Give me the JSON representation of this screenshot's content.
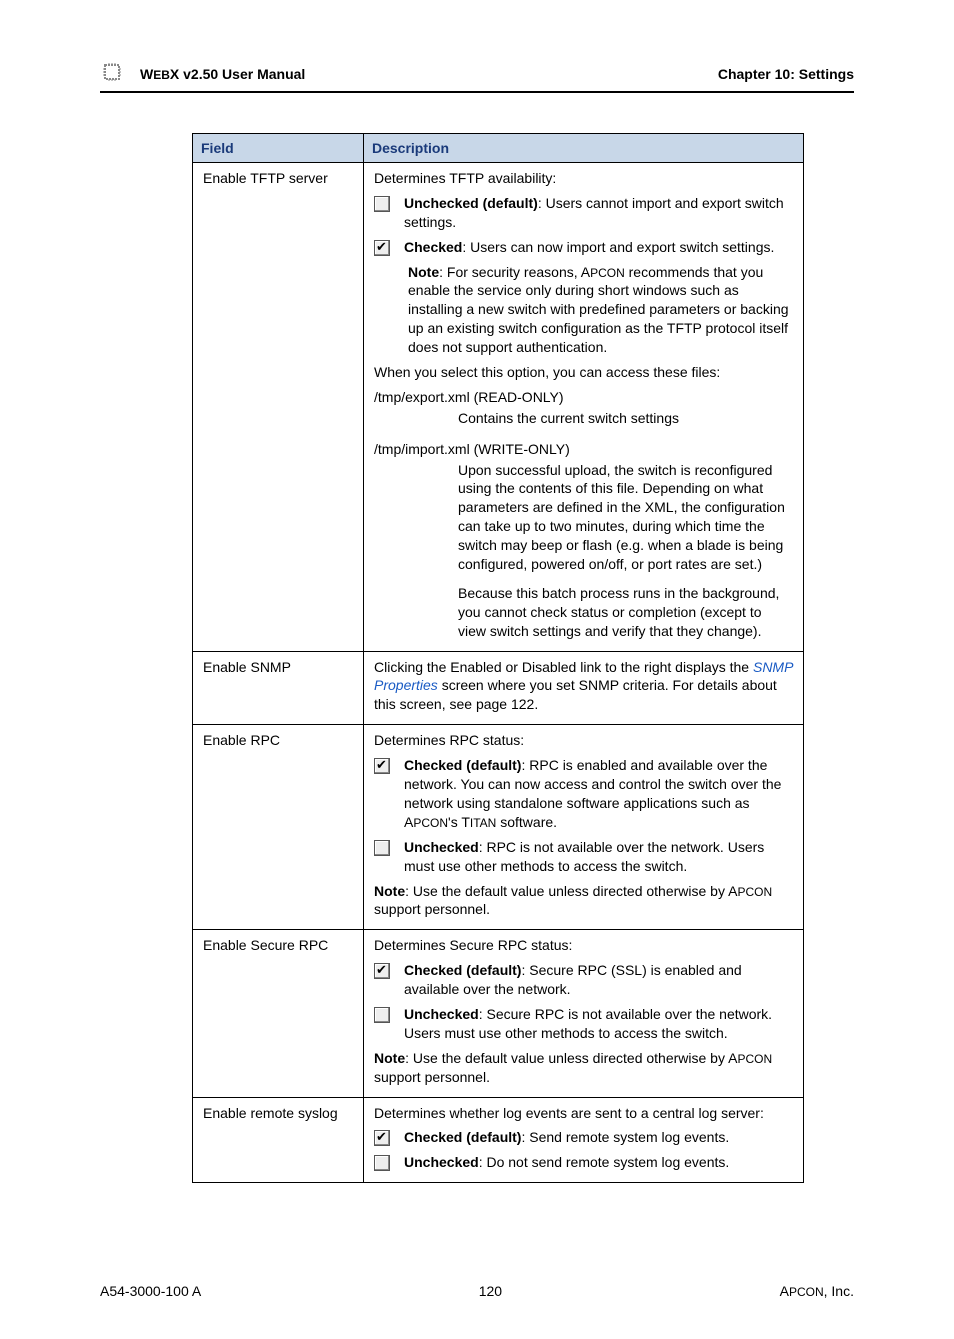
{
  "header": {
    "doc_title_prefix": "W",
    "doc_title_smallcaps": "EB",
    "doc_title_rest": "X v2.50 User Manual",
    "chapter": "Chapter 10: Settings"
  },
  "table": {
    "col1": "Field",
    "col2": "Description",
    "rows": {
      "tftp": {
        "field": "Enable TFTP server",
        "intro": "Determines TFTP availability:",
        "unchecked_bold": "Unchecked (default)",
        "unchecked_text": ": Users cannot import and export switch settings.",
        "checked_bold": "Checked",
        "checked_text": ": Users can now import and export switch settings.",
        "note_bold": "Note",
        "note_text_1": ": For security reasons, A",
        "note_text_smallcaps": "PCON",
        "note_text_2": " recommends that you enable the service only during short windows such as installing a new switch with predefined parameters or backing up an existing switch configuration as the TFTP protocol itself does not support authentication.",
        "access_line": "When you select this option, you can access these files:",
        "export_path": "/tmp/export.xml (READ-ONLY)",
        "export_desc": "Contains the current switch settings",
        "import_path": "/tmp/import.xml (WRITE-ONLY)",
        "import_desc": "Upon successful upload, the switch is reconfigured using the contents of this file. Depending on what parameters are defined in the XML, the configuration can take up to two minutes, during which time the switch may beep or flash (e.g. when a blade is being configured, powered on/off, or port rates are set.)",
        "import_desc2": "Because this batch process runs in the background, you cannot check status or completion (except to view switch settings and verify that they change)."
      },
      "snmp": {
        "field": "Enable SNMP",
        "text1": "Clicking the Enabled or Disabled link to the right displays the ",
        "link": "SNMP Properties",
        "text2": " screen where you set SNMP criteria. For details about this screen, see page 122."
      },
      "rpc": {
        "field": "Enable RPC",
        "intro": "Determines RPC status:",
        "checked_bold": "Checked (default)",
        "checked_text_1": ": RPC is enabled and available over the network. You can now access and control the switch over the network using standalone software applications such as A",
        "checked_smallcaps1": "PCON",
        "checked_text_2": "'s T",
        "checked_smallcaps2": "ITAN",
        "checked_text_3": " software.",
        "unchecked_bold": "Unchecked",
        "unchecked_text": ": RPC is not available over the network. Users must use other methods to access the switch.",
        "note_bold": "Note",
        "note_text_1": ": Use the default value unless directed otherwise by A",
        "note_smallcaps": "PCON",
        "note_text_2": " support personnel."
      },
      "srpc": {
        "field": "Enable Secure RPC",
        "intro": "Determines Secure RPC status:",
        "checked_bold": "Checked (default)",
        "checked_text": ": Secure RPC (SSL) is enabled and available over the network.",
        "unchecked_bold": "Unchecked",
        "unchecked_text": ": Secure RPC is not available over the network. Users must use other methods to access the switch.",
        "note_bold": "Note",
        "note_text_1": ": Use the default value unless directed otherwise by A",
        "note_smallcaps": "PCON",
        "note_text_2": " support personnel."
      },
      "syslog": {
        "field": "Enable remote syslog",
        "intro": "Determines whether log events are sent to a central log server:",
        "checked_bold": "Checked (default)",
        "checked_text": ": Send remote system log events.",
        "unchecked_bold": "Unchecked",
        "unchecked_text": ": Do not send remote system log events."
      }
    }
  },
  "footer": {
    "left": "A54-3000-100 A",
    "center": "120",
    "right_1": "A",
    "right_smallcaps": "PCON",
    "right_2": ", Inc."
  }
}
